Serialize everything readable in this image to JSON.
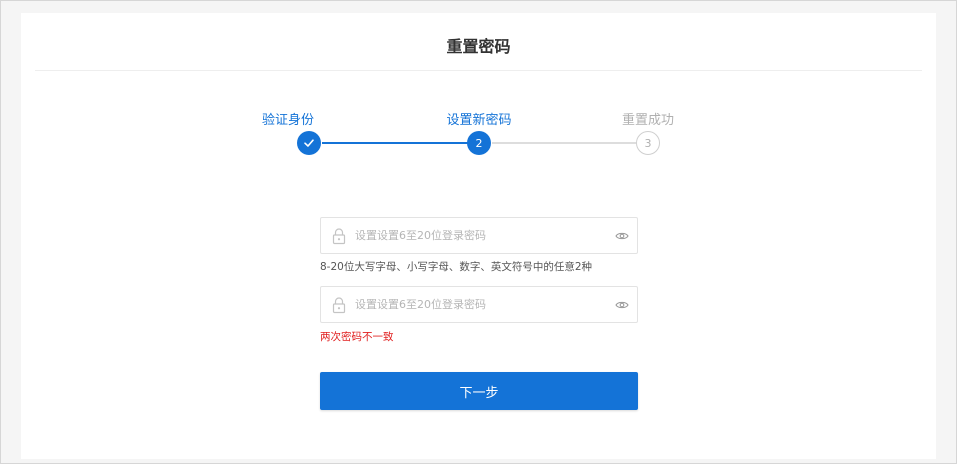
{
  "page": {
    "title": "重置密码"
  },
  "steps": [
    {
      "label": "验证身份",
      "number": "",
      "state": "done"
    },
    {
      "label": "设置新密码",
      "number": "2",
      "state": "active"
    },
    {
      "label": "重置成功",
      "number": "3",
      "state": "pending"
    }
  ],
  "form": {
    "password": {
      "placeholder": "设置设置6至20位登录密码",
      "value": "",
      "hint": "8-20位大写字母、小写字母、数字、英文符号中的任意2种"
    },
    "confirm": {
      "placeholder": "设置设置6至20位登录密码",
      "value": "",
      "error": "两次密码不一致"
    },
    "next_label": "下一步"
  },
  "colors": {
    "accent": "#1473d7",
    "error": "#e02020",
    "pending": "#b0b0b0",
    "line_pending": "#dddddd"
  },
  "icons": {
    "step_done": "check-icon",
    "input_left": "lock-icon",
    "input_right": "eye-icon"
  }
}
